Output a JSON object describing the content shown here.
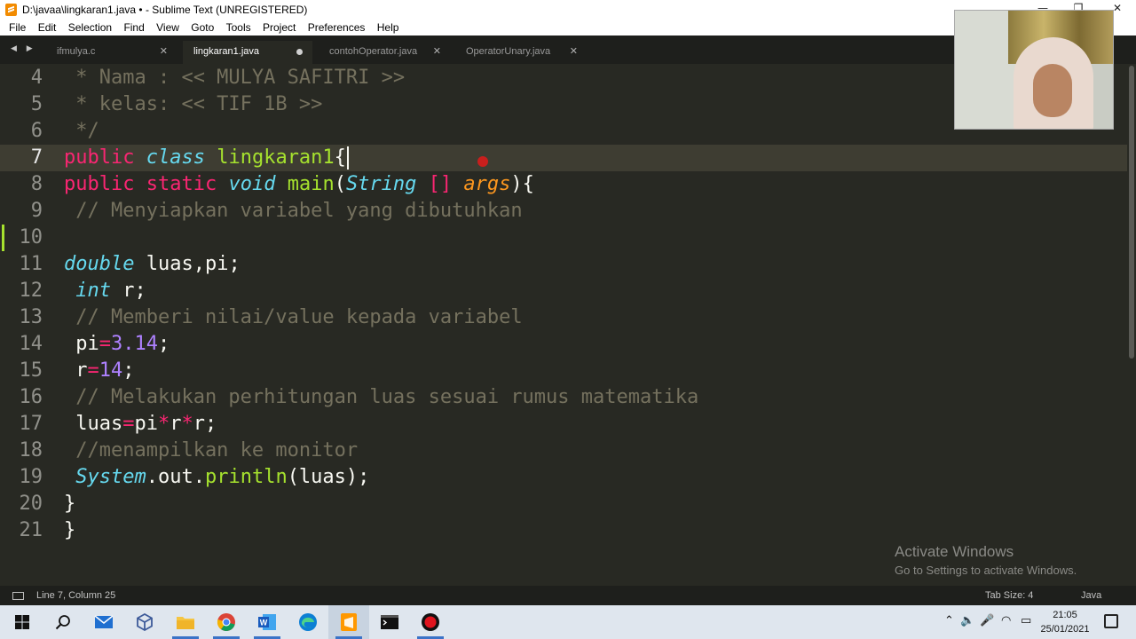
{
  "window": {
    "title": "D:\\javaa\\lingkaran1.java • - Sublime Text (UNREGISTERED)",
    "minimize": "—",
    "maximize": "❐",
    "close": "✕"
  },
  "menu": [
    "File",
    "Edit",
    "Selection",
    "Find",
    "View",
    "Goto",
    "Tools",
    "Project",
    "Preferences",
    "Help"
  ],
  "tabs": [
    {
      "label": "ifmulya.c",
      "state": "close",
      "close": "✕"
    },
    {
      "label": "lingkaran1.java",
      "state": "modified",
      "active": true
    },
    {
      "label": "contohOperator.java",
      "state": "close",
      "close": "✕"
    },
    {
      "label": "OperatorUnary.java",
      "state": "close",
      "close": "✕"
    }
  ],
  "nav_arrows": "◀ ▶",
  "editor": {
    "current_line": 7,
    "line_numbers": [
      "4",
      "5",
      "6",
      "7",
      "8",
      "9",
      "10",
      "11",
      "12",
      "13",
      "14",
      "15",
      "16",
      "17",
      "18",
      "19",
      "20",
      "21"
    ],
    "lines": [
      {
        "tokens": [
          [
            "c",
            " * Nama : << MULYA SAFITRI >>"
          ]
        ]
      },
      {
        "tokens": [
          [
            "c",
            " * kelas: << TIF 1B >>"
          ]
        ]
      },
      {
        "tokens": [
          [
            "c",
            " */"
          ]
        ]
      },
      {
        "tokens": [
          [
            "k",
            "public"
          ],
          [
            "p",
            " "
          ],
          [
            "t",
            "class"
          ],
          [
            "p",
            " "
          ],
          [
            "f",
            "lingkaran1"
          ],
          [
            "p",
            "{"
          ]
        ]
      },
      {
        "tokens": [
          [
            "k",
            "public"
          ],
          [
            "p",
            " "
          ],
          [
            "k",
            "static"
          ],
          [
            "p",
            " "
          ],
          [
            "t",
            "void"
          ],
          [
            "p",
            " "
          ],
          [
            "f",
            "main"
          ],
          [
            "p",
            "("
          ],
          [
            "t",
            "String"
          ],
          [
            "p",
            " "
          ],
          [
            "k",
            "[]"
          ],
          [
            "p",
            " "
          ],
          [
            "a",
            "args"
          ],
          [
            "p",
            "){"
          ]
        ]
      },
      {
        "tokens": [
          [
            "c",
            " // Menyiapkan variabel yang dibutuhkan"
          ]
        ]
      },
      {
        "tokens": []
      },
      {
        "tokens": [
          [
            "t",
            "double"
          ],
          [
            "p",
            " luas,pi;"
          ]
        ]
      },
      {
        "tokens": [
          [
            "p",
            " "
          ],
          [
            "t",
            "int"
          ],
          [
            "p",
            " r;"
          ]
        ]
      },
      {
        "tokens": [
          [
            "c",
            " // Memberi nilai/value kepada variabel"
          ]
        ]
      },
      {
        "tokens": [
          [
            "p",
            " pi"
          ],
          [
            "k",
            "="
          ],
          [
            "n",
            "3.14"
          ],
          [
            "p",
            ";"
          ]
        ]
      },
      {
        "tokens": [
          [
            "p",
            " r"
          ],
          [
            "k",
            "="
          ],
          [
            "n",
            "14"
          ],
          [
            "p",
            ";"
          ]
        ]
      },
      {
        "tokens": [
          [
            "c",
            " // Melakukan perhitungan luas sesuai rumus matematika"
          ]
        ]
      },
      {
        "tokens": [
          [
            "p",
            " luas"
          ],
          [
            "k",
            "="
          ],
          [
            "p",
            "pi"
          ],
          [
            "k",
            "*"
          ],
          [
            "p",
            "r"
          ],
          [
            "k",
            "*"
          ],
          [
            "p",
            "r;"
          ]
        ]
      },
      {
        "tokens": [
          [
            "c",
            " //menampilkan ke monitor"
          ]
        ]
      },
      {
        "tokens": [
          [
            "p",
            " "
          ],
          [
            "t",
            "System"
          ],
          [
            "p",
            ".out."
          ],
          [
            "f",
            "println"
          ],
          [
            "p",
            "(luas);"
          ]
        ]
      },
      {
        "tokens": [
          [
            "p",
            "}"
          ]
        ]
      },
      {
        "tokens": [
          [
            "p",
            "}"
          ]
        ]
      }
    ]
  },
  "watermark": {
    "title": "Activate Windows",
    "subtitle": "Go to Settings to activate Windows."
  },
  "status": {
    "position": "Line 7, Column 25",
    "tab_size": "Tab Size: 4",
    "syntax": "Java"
  },
  "taskbar": {
    "items": [
      "windows-start",
      "search",
      "mail",
      "3d-viewer",
      "file-explorer",
      "chrome",
      "word",
      "edge",
      "sublime-text",
      "terminal",
      "recorder"
    ],
    "tray": {
      "chevron": "⌃",
      "volume": "🔈",
      "mic": "🎤",
      "wifi": "◠",
      "battery": "▭"
    },
    "time": "21:05",
    "date": "25/01/2021"
  },
  "colors": {
    "editor_bg": "#282923",
    "comment": "#75715e",
    "keyword": "#f92672",
    "type": "#66d9ef",
    "function": "#a6e22e",
    "number": "#ae81ff",
    "argument": "#fd971f",
    "taskbar_bg": "#dfe6ee"
  }
}
